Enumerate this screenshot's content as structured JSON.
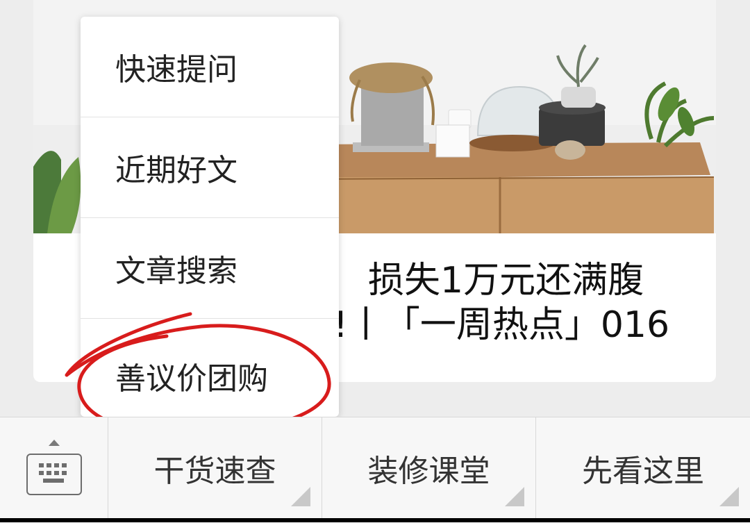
{
  "article": {
    "title_line1": "损失1万元还满腹",
    "title_line2": "!丨「一周热点」016",
    "image_alt": "room-interior-photo"
  },
  "popup_menu": {
    "items": [
      {
        "label": "快速提问"
      },
      {
        "label": "近期好文"
      },
      {
        "label": "文章搜索"
      },
      {
        "label": "善议价团购",
        "highlighted": true
      }
    ]
  },
  "annotation": {
    "color": "#d81c1c",
    "shape": "hand-drawn circle"
  },
  "bottom_bar": {
    "keyboard_icon": "keyboard-icon",
    "tabs": [
      {
        "label": "干货速查"
      },
      {
        "label": "装修课堂"
      },
      {
        "label": "先看这里"
      }
    ]
  }
}
